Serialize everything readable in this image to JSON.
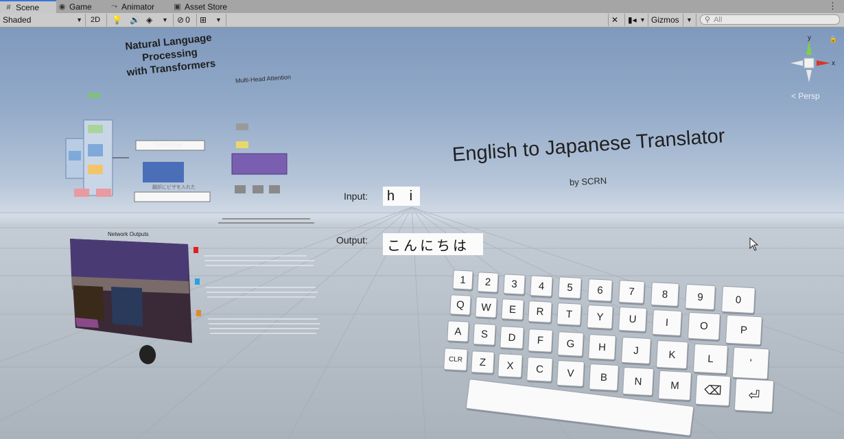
{
  "tabs": [
    {
      "label": "Scene",
      "icon": "grid-icon",
      "active": true
    },
    {
      "label": "Game",
      "icon": "gamepad-icon",
      "active": false
    },
    {
      "label": "Animator",
      "icon": "animator-icon",
      "active": false
    },
    {
      "label": "Asset Store",
      "icon": "store-icon",
      "active": false
    }
  ],
  "toolbar": {
    "shading_mode": "Shaded",
    "mode_2d": "2D",
    "hidden_count": "0",
    "gizmos_label": "Gizmos",
    "search_placeholder": "All"
  },
  "scene": {
    "projection_label": "< Persp",
    "gizmo_axes": {
      "y": "y",
      "x": "x"
    },
    "poster_title_line1": "Natural Language Processing",
    "poster_title_line2": "with Transformers",
    "poster_transformer_label": "Transformer",
    "poster_multihead_title": "Multi-Head Attention",
    "poster_japanese_caption": "翻訳にビザを入れた",
    "network_outputs_title": "Network Outputs",
    "translator_title": "English to Japanese Translator",
    "translator_subtitle": "by SCRN",
    "input_label": "Input:",
    "input_value": "h i",
    "output_label": "Output:",
    "output_value": "こんにちは",
    "keyboard_rows": [
      [
        "1",
        "2",
        "3",
        "4",
        "5",
        "6",
        "7",
        "8",
        "9",
        "0"
      ],
      [
        "Q",
        "W",
        "E",
        "R",
        "T",
        "Y",
        "U",
        "I",
        "O",
        "P"
      ],
      [
        "A",
        "S",
        "D",
        "F",
        "G",
        "H",
        "J",
        "K",
        "L",
        "'"
      ],
      [
        "CLR",
        "Z",
        "X",
        "C",
        "V",
        "B",
        "N",
        "M",
        "⌫",
        "⏎"
      ]
    ]
  }
}
